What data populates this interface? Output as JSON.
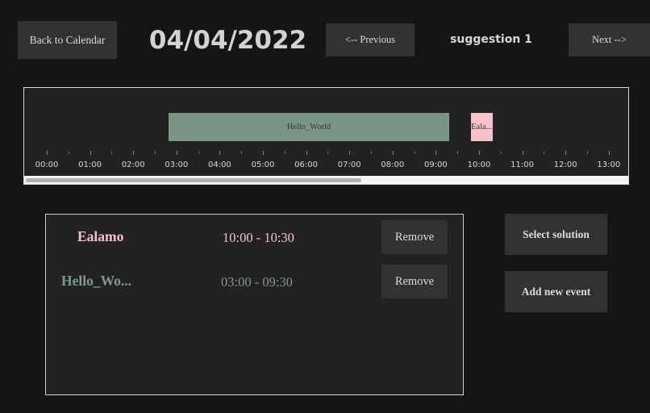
{
  "header": {
    "back_label": "Back to Calendar",
    "date": "04/04/2022",
    "prev_label": "<-- Previous",
    "suggestion": "suggestion 1",
    "next_label": "Next  -->"
  },
  "timeline": {
    "events": [
      {
        "label": "Hello_World",
        "start": "03:00",
        "end": "09:30",
        "color": "#7a9485"
      },
      {
        "label": "Eala...",
        "start": "10:00",
        "end": "10:30",
        "color": "#f7c0cb"
      }
    ],
    "hours": [
      "00:00",
      "01:00",
      "02:00",
      "03:00",
      "04:00",
      "05:00",
      "06:00",
      "07:00",
      "08:00",
      "09:00",
      "10:00",
      "11:00",
      "12:00",
      "13:00"
    ]
  },
  "event_list": [
    {
      "name": "Ealamo",
      "time": "10:00 - 10:30",
      "color": "#f3c2cc",
      "remove_label": "Remove"
    },
    {
      "name": "Hello_Wo...",
      "time": "03:00 - 09:30",
      "color": "#7f9988",
      "remove_label": "Remove"
    }
  ],
  "actions": {
    "select_label": "Select solution",
    "add_label": "Add new event"
  }
}
